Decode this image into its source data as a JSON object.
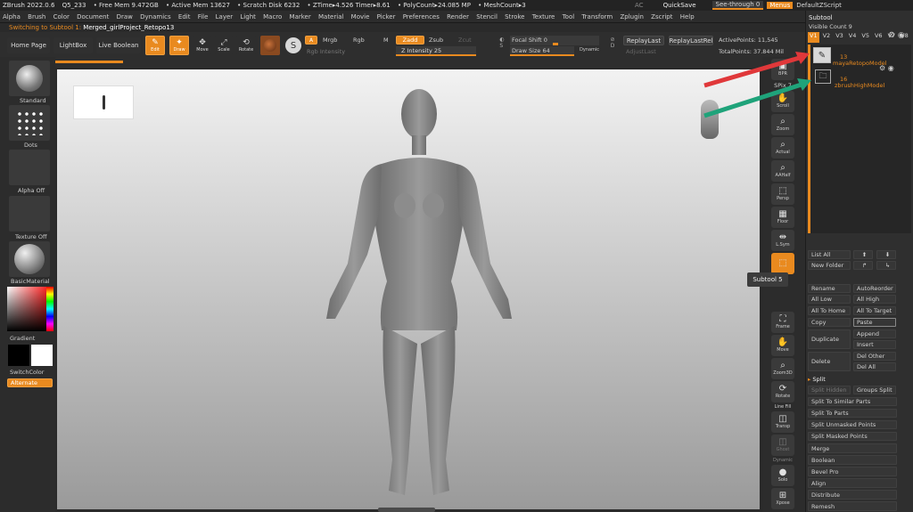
{
  "titlebar": {
    "items": [
      "ZBrush 2022.0.6",
      "Q5_233",
      "• Free Mem 9.472GB",
      "• Active Mem 13627",
      "• Scratch Disk 6232",
      "• ZTime▸4.526 Timer▸8.61",
      "• PolyCount▸24.085 MP",
      "• MeshCount▸3"
    ],
    "right_items": [
      "AC",
      "QuickSave",
      "See-through",
      "0",
      "Menus",
      "DefaultZScript"
    ]
  },
  "menubar": {
    "items": [
      "Alpha",
      "Brush",
      "Color",
      "Document",
      "Draw",
      "Dynamics",
      "Edit",
      "File",
      "Layer",
      "Light",
      "Macro",
      "Marker",
      "Material",
      "Movie",
      "Picker",
      "Preferences",
      "Render",
      "Stencil",
      "Stroke",
      "Texture",
      "Tool",
      "Transform",
      "Zplugin",
      "Zscript",
      "Help"
    ]
  },
  "status": {
    "notice": "Switching to Subtool 1:",
    "project": "Merged_girlProject_Retopo13"
  },
  "topnav": {
    "home": "Home Page",
    "lightbox": "LightBox",
    "liveboolean": "Live Boolean"
  },
  "modes": {
    "edit": "Edit",
    "draw": "Draw",
    "move": "Move",
    "scale": "Scale",
    "rotate": "Rotate"
  },
  "shelf": {
    "a": "A",
    "mrgb": "Mrgb",
    "rgb": "Rgb",
    "m": "M",
    "zadd": "Zadd",
    "zsub": "Zsub",
    "zcut": "Zcut",
    "rgb_intensity": "Rgb Intensity",
    "z_intensity": "Z Intensity 25",
    "focal_shift": "Focal Shift 0",
    "draw_size": "Draw Size 64",
    "dynamic": "Dynamic",
    "replaylast": "ReplayLast",
    "replaylastrel": "ReplayLastRel",
    "adjustlast": "AdjustLast",
    "active_points": "ActivePoints: 11,545",
    "total_points": "TotalPoints: 37.844 Mil"
  },
  "leftpanel": {
    "standard": "Standard",
    "dots": "Dots",
    "alpha_off": "Alpha Off",
    "texture_off": "Texture Off",
    "material": "BasicMaterial",
    "gradient": "Gradient",
    "switchcolor": "SwitchColor",
    "alternate": "Alternate"
  },
  "righttools": {
    "bpr": "BPR",
    "spix": "SPix 7",
    "scroll": "Scroll",
    "zoom": "Zoom",
    "actual": "Actual",
    "aahalf": "AAHalf",
    "persp": "Persp",
    "floor": "Floor",
    "lsym": "L.Sym",
    "frame": "Frame",
    "move": "Move",
    "zoom3d": "Zoom3D",
    "rotate": "Rotate",
    "linefill": "Line Fill",
    "transp": "Transp",
    "ghost": "Ghost",
    "dynamic": "Dynamic",
    "solo": "Solo",
    "xpose": "Xpose"
  },
  "tooltip": "Subtool 5",
  "subtool": {
    "title": "Subtool",
    "visible_count": "Visible Count 9",
    "versions": [
      "V1",
      "V2",
      "V3",
      "V4",
      "V5",
      "V6",
      "V7",
      "V8"
    ],
    "items": [
      {
        "count": "13",
        "name": "mayaRetopoModel"
      },
      {
        "count": "16",
        "name": "zbrushHighModel"
      }
    ],
    "list_all": "List All",
    "new_folder": "New Folder",
    "rename": "Rename",
    "autoreorder": "AutoReorder",
    "all_low": "All Low",
    "all_high": "All High",
    "all_to_home": "All To Home",
    "all_to_target": "All To Target",
    "copy": "Copy",
    "paste": "Paste",
    "duplicate": "Duplicate",
    "append": "Append",
    "insert": "Insert",
    "delete": "Delete",
    "del_other": "Del Other",
    "del_all": "Del All",
    "split": "Split",
    "split_hidden": "Split Hidden",
    "groups_split": "Groups Split",
    "split_similar": "Split To Similar Parts",
    "split_parts": "Split To Parts",
    "split_unmasked": "Split Unmasked Points",
    "split_masked": "Split Masked Points",
    "merge": "Merge",
    "boolean": "Boolean",
    "bevel_pro": "Bevel Pro",
    "align": "Align",
    "distribute": "Distribute",
    "remesh": "Remesh"
  },
  "colors": {
    "accent": "#e98a1f",
    "arrow_red": "#e0383a",
    "arrow_green": "#1fa37a"
  }
}
